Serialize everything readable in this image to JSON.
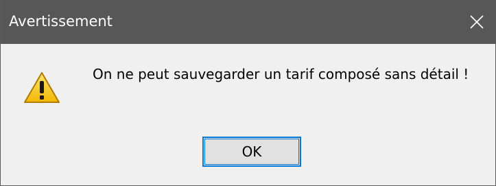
{
  "window": {
    "title": "Avertissement",
    "close_icon": "close-icon"
  },
  "dialog": {
    "icon": "warning-icon",
    "message": "On ne peut sauvegarder un tarif composé sans détail !",
    "ok_label": "OK"
  },
  "colors": {
    "titlebar": "#575757",
    "background": "#f0f0f0",
    "button_border": "#0078d7",
    "warning_yellow": "#f5c21b"
  }
}
